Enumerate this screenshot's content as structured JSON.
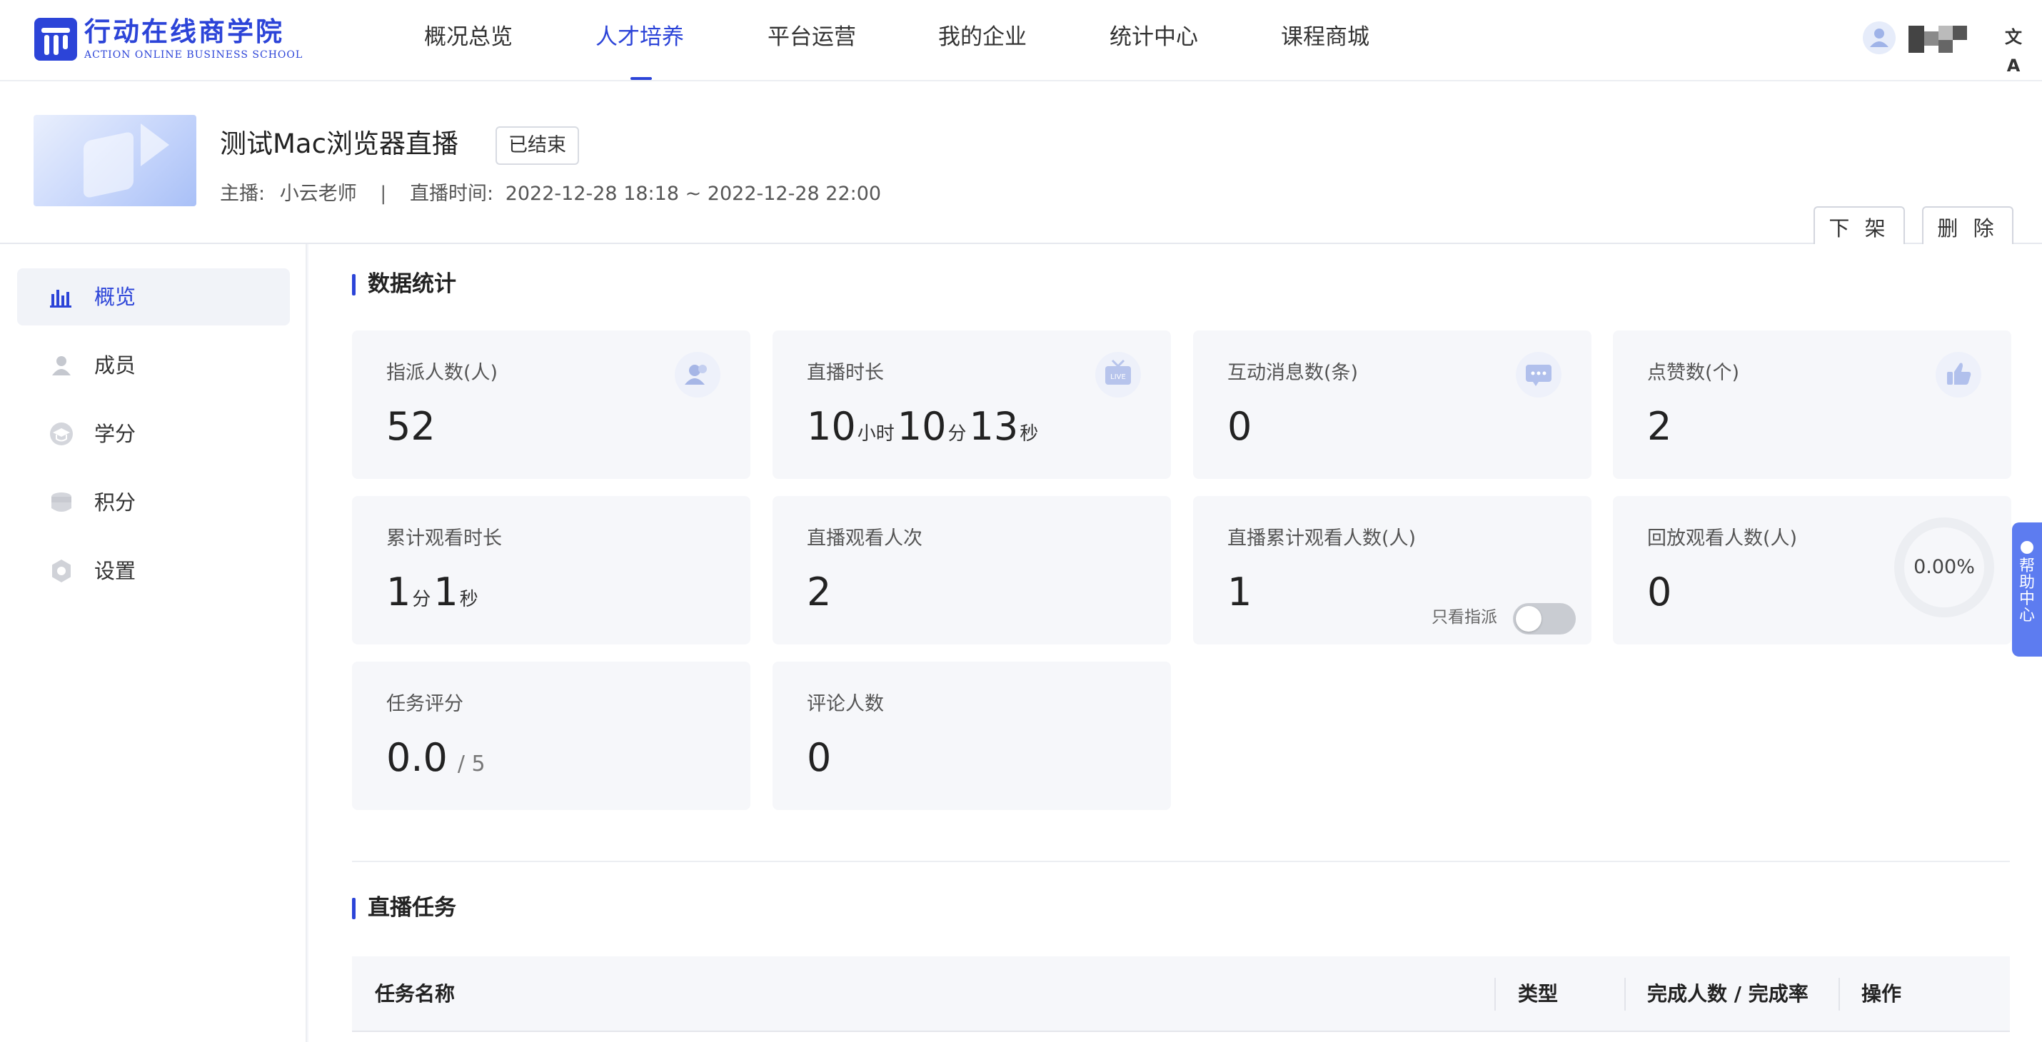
{
  "brand": {
    "name_cn": "行动在线商学院",
    "name_en": "ACTION ONLINE BUSINESS SCHOOL",
    "color": "#2c44d8"
  },
  "nav": {
    "items": [
      "概况总览",
      "人才培养",
      "平台运营",
      "我的企业",
      "统计中心",
      "课程商城"
    ],
    "active": "人才培养",
    "translate_icon": "文A"
  },
  "course": {
    "title": "测试Mac浏览器直播",
    "status": "已结束",
    "host_label": "主播:",
    "host": "小云老师",
    "separator": "|",
    "time_label": "直播时间:",
    "time_range": "2022-12-28 18:18 ~ 2022-12-28 22:00",
    "actions": {
      "unlist": "下 架",
      "delete": "删 除"
    }
  },
  "sidebar": {
    "items": [
      {
        "label": "概览",
        "icon": "bar-chart-icon",
        "active": true
      },
      {
        "label": "成员",
        "icon": "user-icon",
        "active": false
      },
      {
        "label": "学分",
        "icon": "graduation-cap-icon",
        "active": false
      },
      {
        "label": "积分",
        "icon": "coins-icon",
        "active": false
      },
      {
        "label": "设置",
        "icon": "gear-icon",
        "active": false
      }
    ]
  },
  "stats": {
    "section_title": "数据统计",
    "assigned": {
      "label": "指派人数(人)",
      "value": "52",
      "icon": "people-icon"
    },
    "duration": {
      "label": "直播时长",
      "h": "10",
      "h_unit": "小时",
      "m": "10",
      "m_unit": "分",
      "s": "13",
      "s_unit": "秒",
      "icon": "live-tv-icon"
    },
    "messages": {
      "label": "互动消息数(条)",
      "value": "0",
      "icon": "chat-bubble-icon"
    },
    "likes": {
      "label": "点赞数(个)",
      "value": "2",
      "icon": "thumbs-up-icon"
    },
    "watch_time": {
      "label": "累计观看时长",
      "m": "1",
      "m_unit": "分",
      "s": "1",
      "s_unit": "秒"
    },
    "live_views": {
      "label": "直播观看人次",
      "value": "2"
    },
    "live_viewers": {
      "label": "直播累计观看人数(人)",
      "value": "1",
      "toggle_label": "只看指派",
      "toggle_on": false
    },
    "replay_viewers": {
      "label": "回放观看人数(人)",
      "value": "0",
      "rate": "0.00%"
    },
    "task_score": {
      "label": "任务评分",
      "value": "0.0",
      "max": "/ 5"
    },
    "commenters": {
      "label": "评论人数",
      "value": "0"
    }
  },
  "tasks": {
    "section_title": "直播任务",
    "columns": [
      "任务名称",
      "类型",
      "完成人数 / 完成率",
      "操作"
    ]
  },
  "help": {
    "label": "帮助中心"
  }
}
